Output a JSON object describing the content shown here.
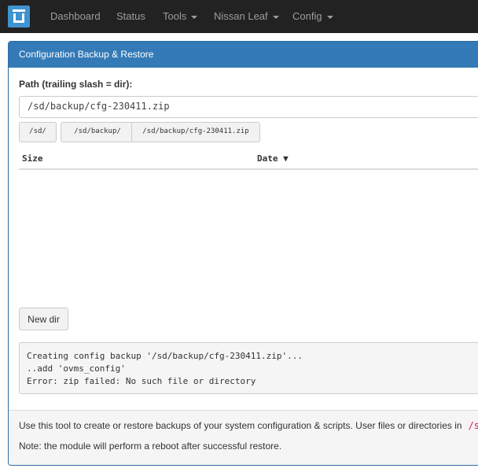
{
  "navbar": {
    "items": [
      {
        "label": "Dashboard"
      },
      {
        "label": "Status"
      },
      {
        "label": "Tools"
      },
      {
        "label": "Nissan Leaf"
      },
      {
        "label": "Config"
      }
    ]
  },
  "panel": {
    "title": "Configuration Backup & Restore",
    "path_label": "Path (trailing slash = dir):",
    "path_value": "/sd/backup/cfg-230411.zip",
    "quick_paths": [
      "/sd/",
      "/sd/backup/",
      "/sd/backup/cfg-230411.zip"
    ],
    "table": {
      "col_size": "Size",
      "col_date": "Date",
      "sort_indicator": "▼"
    },
    "new_dir_label": "New dir",
    "log_lines": [
      "Creating config backup '/sd/backup/cfg-230411.zip'...",
      "..add 'ovms_config'",
      "Error: zip failed: No such file or directory"
    ],
    "footer": {
      "line1": "Use this tool to create or restore backups of your system configuration & scripts. User files or directories in",
      "line1_code": "/store",
      "line2": "Note: the module will perform a reboot after successful restore."
    }
  }
}
